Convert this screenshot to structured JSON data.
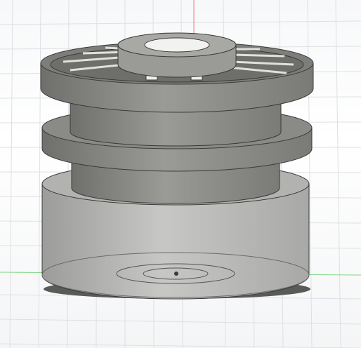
{
  "viewport": {
    "background_color": "#ffffff",
    "grid_line_color": "#d9dde3",
    "axis_red_color": "#ff6b6b",
    "axis_green_color": "#76d47b"
  },
  "model": {
    "body_color": "#8f8f8c",
    "edge_color": "#3a3a3a",
    "flange_top_color": "#7d7d7a",
    "hub_color": "#a0a09d",
    "slot_color": "#efefec",
    "base_transparent_color": "#b8b8b6"
  }
}
